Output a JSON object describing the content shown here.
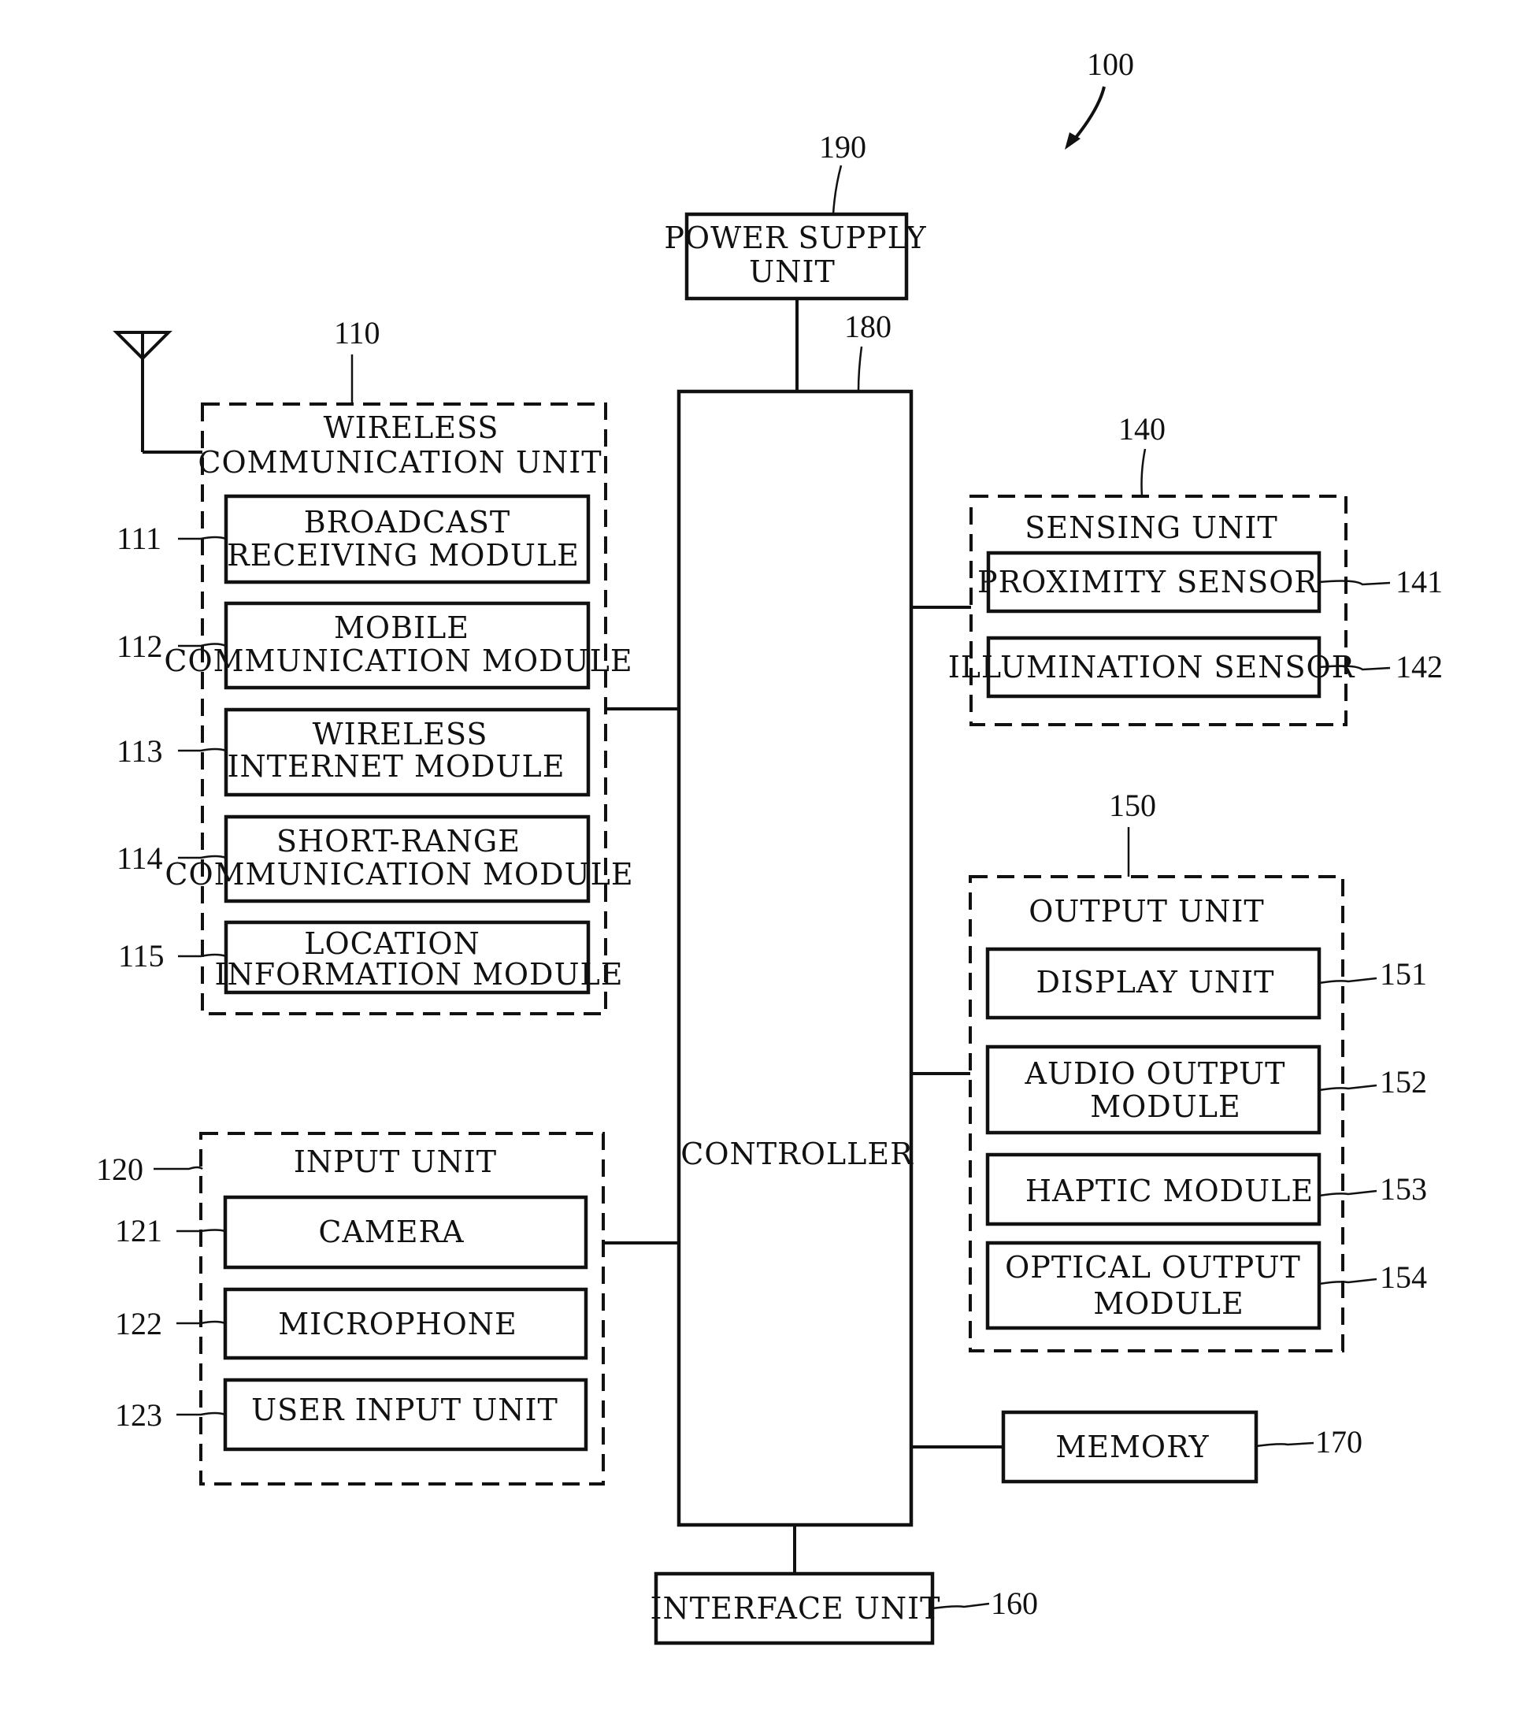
{
  "figure": {
    "ref": "100",
    "power_supply": {
      "ref": "190",
      "lines": [
        "POWER SUPPLY",
        "UNIT"
      ]
    },
    "controller": {
      "ref": "180",
      "label": "CONTROLLER"
    },
    "wireless": {
      "ref": "110",
      "title_lines": [
        "WIRELESS",
        "COMMUNICATION UNIT"
      ],
      "modules": [
        {
          "ref": "111",
          "lines": [
            "BROADCAST",
            "RECEIVING MODULE"
          ]
        },
        {
          "ref": "112",
          "lines": [
            "MOBILE",
            "COMMUNICATION MODULE"
          ]
        },
        {
          "ref": "113",
          "lines": [
            "WIRELESS",
            "INTERNET MODULE"
          ]
        },
        {
          "ref": "114",
          "lines": [
            "SHORT-RANGE",
            "COMMUNICATION MODULE"
          ]
        },
        {
          "ref": "115",
          "lines": [
            "LOCATION",
            "INFORMATION MODULE"
          ]
        }
      ]
    },
    "input": {
      "ref": "120",
      "title": "INPUT UNIT",
      "modules": [
        {
          "ref": "121",
          "label": "CAMERA"
        },
        {
          "ref": "122",
          "label": "MICROPHONE"
        },
        {
          "ref": "123",
          "label": "USER INPUT UNIT"
        }
      ]
    },
    "sensing": {
      "ref": "140",
      "title": "SENSING UNIT",
      "modules": [
        {
          "ref": "141",
          "label": "PROXIMITY SENSOR"
        },
        {
          "ref": "142",
          "label": "ILLUMINATION SENSOR"
        }
      ]
    },
    "output": {
      "ref": "150",
      "title": "OUTPUT UNIT",
      "modules": [
        {
          "ref": "151",
          "lines": [
            "DISPLAY UNIT"
          ]
        },
        {
          "ref": "152",
          "lines": [
            "AUDIO OUTPUT",
            "MODULE"
          ]
        },
        {
          "ref": "153",
          "lines": [
            "HAPTIC MODULE"
          ]
        },
        {
          "ref": "154",
          "lines": [
            "OPTICAL OUTPUT",
            "MODULE"
          ]
        }
      ]
    },
    "memory": {
      "ref": "170",
      "label": "MEMORY"
    },
    "interface": {
      "ref": "160",
      "label": "INTERFACE UNIT"
    }
  }
}
